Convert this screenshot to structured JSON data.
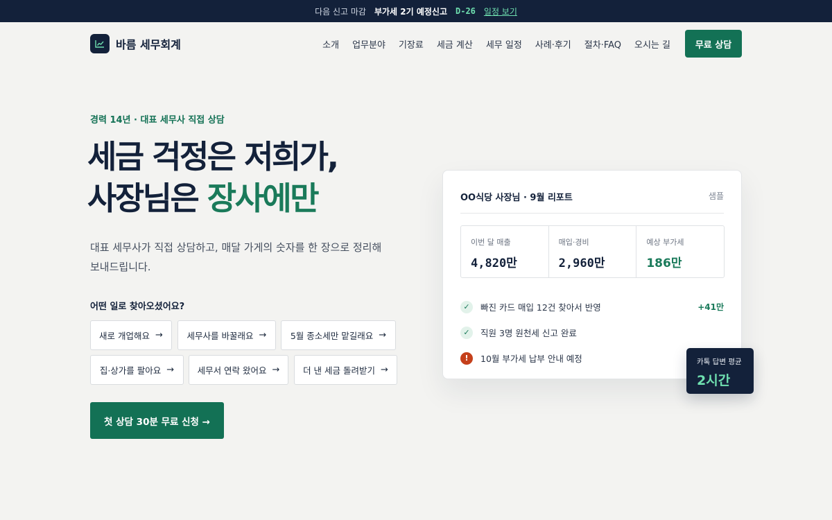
{
  "topbar": {
    "prefix": "다음 신고 마감",
    "deadline": "부가세 2기 예정신고",
    "dday": "D-26",
    "link": "일정 보기"
  },
  "brand": {
    "name": "바름 세무회계",
    "logo_icon": "chart-line-icon"
  },
  "nav": {
    "items": [
      "소개",
      "업무분야",
      "기장료",
      "세금 계산",
      "세무 일정",
      "사례·후기",
      "절차·FAQ",
      "오시는 길"
    ],
    "cta": "무료 상담"
  },
  "hero": {
    "eyebrow": "경력 14년 · 대표 세무사 직접 상담",
    "title_line1": "세금 걱정은 저희가,",
    "title_line2_prefix": "사장님은",
    "title_line2_accent": "장사에만",
    "subtitle": "대표 세무사가 직접 상담하고, 매달 가게의 숫자를 한 장으로 정리해 보내드립니다.",
    "question": "어떤 일로 찾아오셨어요?",
    "options": [
      "새로 개업해요",
      "세무사를 바꿀래요",
      "5월 종소세만 맡길래요",
      "집·상가를 팔아요",
      "세무서 연락 왔어요",
      "더 낸 세금 돌려받기"
    ],
    "option_arrow": "→",
    "cta": "첫 상담 30분 무료 신청 →"
  },
  "report": {
    "title": "OO식당 사장님 · 9월 리포트",
    "tag": "샘플",
    "stats": [
      {
        "label": "이번 달 매출",
        "value": "4,820만"
      },
      {
        "label": "매입·경비",
        "value": "2,960만"
      },
      {
        "label": "예상 부가세",
        "value": "186만"
      }
    ],
    "items": [
      {
        "text": "빠진 카드 매입 12건 찾아서 반영",
        "delta": "+41만",
        "status": "ok"
      },
      {
        "text": "직원 3명 원천세 신고 완료",
        "delta": "",
        "status": "ok"
      },
      {
        "text": "10월 부가세 납부 안내 예정",
        "delta": "",
        "status": "warn"
      }
    ],
    "check_glyph": "✓",
    "warn_glyph": "!"
  },
  "reply_badge": {
    "label": "카톡 답변 평균",
    "value": "2시간"
  },
  "colors": {
    "navy": "#13213a",
    "green": "#137155",
    "mint": "#6fe0b0",
    "alert": "#c5401b"
  }
}
